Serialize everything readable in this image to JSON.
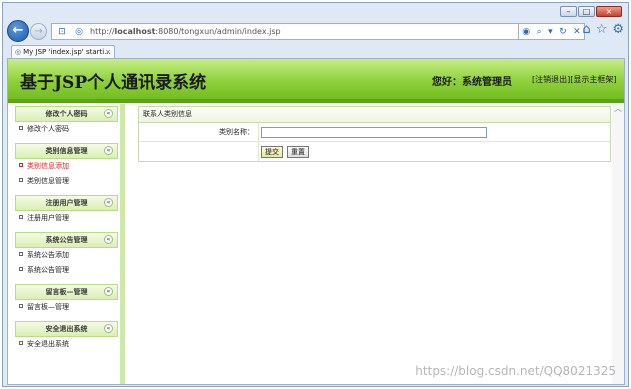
{
  "browser": {
    "url_prefix": "http://",
    "url_host": "localhost",
    "url_rest": ":8080/tongxun/admin/index.jsp",
    "tab_title": "My JSP 'index.jsp' starti...",
    "tab_close": "×",
    "back_glyph": "←",
    "forward_glyph": "→",
    "win_min": "–",
    "win_max": "□",
    "win_close": "×"
  },
  "banner": {
    "title": "基于JSP个人通讯录系统",
    "greeting": "您好：系统管理员",
    "logout_link": "[注销退出]",
    "home_link": "[显示主框架]"
  },
  "sidebar": {
    "groups": [
      {
        "title": "修改个人密码",
        "items": [
          {
            "label": "修改个人密码",
            "active": false
          }
        ]
      },
      {
        "title": "类别信息管理",
        "items": [
          {
            "label": "类别信息添加",
            "active": true
          },
          {
            "label": "类别信息管理",
            "active": false
          }
        ]
      },
      {
        "title": "注册用户管理",
        "items": [
          {
            "label": "注册用户管理",
            "active": false
          }
        ]
      },
      {
        "title": "系统公告管理",
        "items": [
          {
            "label": "系统公告添加",
            "active": false
          },
          {
            "label": "系统公告管理",
            "active": false
          }
        ]
      },
      {
        "title": "留言板—管理",
        "items": [
          {
            "label": "留言板—管理",
            "active": false
          }
        ]
      },
      {
        "title": "安全退出系统",
        "items": [
          {
            "label": "安全退出系统",
            "active": false
          }
        ]
      }
    ],
    "chevron": "«"
  },
  "form": {
    "panel_title": "联系人类别信息",
    "field_label": "类别名称：",
    "field_value": "",
    "submit_label": "提交",
    "reset_label": "重置"
  },
  "watermark": "https://blog.csdn.net/QQ8021325",
  "icons": [
    "back-icon",
    "forward-icon",
    "page-icon",
    "refresh-icon",
    "search-icon",
    "home-icon",
    "star-icon",
    "gear-icon"
  ],
  "colors": {
    "banner_green": "#8fd13c",
    "active_red": "#e0201e"
  }
}
